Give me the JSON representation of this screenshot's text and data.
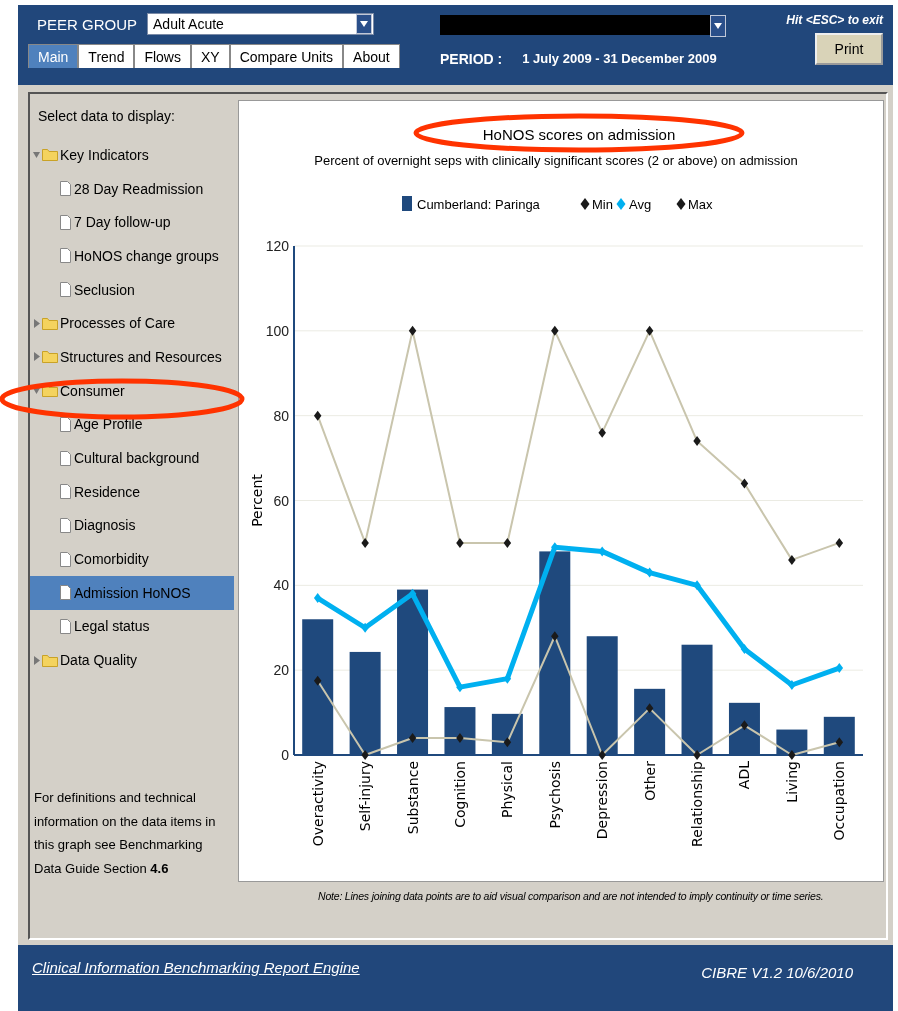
{
  "header": {
    "peer_group": {
      "label": "PEER GROUP",
      "value": "Adult Acute"
    },
    "period": {
      "label": "PERIOD :",
      "value": "1 July 2009 - 31 December 2009"
    },
    "esc_hint": "Hit <ESC> to exit",
    "print_button": "Print"
  },
  "tabs": [
    {
      "label": "Main",
      "selected": true
    },
    {
      "label": "Trend",
      "selected": false
    },
    {
      "label": "Flows",
      "selected": false
    },
    {
      "label": "XY",
      "selected": false
    },
    {
      "label": "Compare Units",
      "selected": false
    },
    {
      "label": "About",
      "selected": false
    }
  ],
  "sidebar": {
    "heading": "Select data to display:",
    "tree": [
      {
        "label": "Key Indicators",
        "expanded": true,
        "children": [
          {
            "label": "28 Day Readmission",
            "selected": false
          },
          {
            "label": "7 Day follow-up",
            "selected": false
          },
          {
            "label": "HoNOS change groups",
            "selected": false
          },
          {
            "label": "Seclusion",
            "selected": false
          }
        ]
      },
      {
        "label": "Processes of Care",
        "expanded": false
      },
      {
        "label": "Structures and Resources",
        "expanded": false
      },
      {
        "label": "Consumer",
        "expanded": true,
        "children": [
          {
            "label": "Age Profile",
            "selected": false
          },
          {
            "label": "Cultural background",
            "selected": false
          },
          {
            "label": "Residence",
            "selected": false
          },
          {
            "label": "Diagnosis",
            "selected": false
          },
          {
            "label": "Comorbidity",
            "selected": false
          },
          {
            "label": "Admission HoNOS",
            "selected": true
          },
          {
            "label": "Legal status",
            "selected": false
          }
        ]
      },
      {
        "label": "Data Quality",
        "expanded": false
      }
    ],
    "footnote": "For definitions and technical information on the data items in this graph see Benchmarking Data Guide Section  **4.6**"
  },
  "chart": {
    "subtitle": "Percent of overnight seps with clinically significant scores (2 or above) on admission",
    "chart_data": {
      "type": "bar",
      "title": "HoNOS scores on admission",
      "ylabel": "Percent",
      "categories": [
        "Overactivity",
        "Self-injury",
        "Substance",
        "Cognition",
        "Physical",
        "Psychosis",
        "Depression",
        "Other",
        "Relationship",
        "ADL",
        "Living",
        "Occupation"
      ],
      "ylim": [
        0,
        120
      ],
      "grid": true,
      "legend": "top",
      "yticks": [
        0,
        20,
        40,
        60,
        80,
        100,
        120
      ],
      "series": [
        {
          "name": "Cumberland: Paringa",
          "color": "#1f497d",
          "values": [
            32,
            24.3,
            39,
            11.3,
            9.7,
            48,
            28,
            15.6,
            26,
            12.3,
            6,
            9
          ]
        },
        {
          "name": "Min",
          "type": "line",
          "color": "#c9c5ad",
          "marker": "diamond",
          "values": [
            17.5,
            0,
            4,
            4,
            3,
            28,
            0,
            11,
            0,
            7,
            0,
            3
          ]
        },
        {
          "name": "Avg",
          "type": "line",
          "color": "#00b0f0",
          "marker": "diamond",
          "values": [
            37,
            30,
            38,
            16,
            18,
            49,
            48,
            43,
            40,
            25,
            16.5,
            20.5
          ]
        },
        {
          "name": "Max",
          "type": "line",
          "color": "#c9c5ad",
          "marker": "diamond",
          "values": [
            80,
            50,
            100,
            50,
            50,
            100,
            76,
            100,
            74,
            64,
            46,
            50
          ]
        }
      ]
    },
    "note": "Note: Lines joining data points are to aid visual comparison and are not intended to imply continuity or time series."
  },
  "footer": {
    "link": "Clinical Information Benchmarking Report Engine",
    "version": "CIBRE V1.2  10/6/2010"
  }
}
